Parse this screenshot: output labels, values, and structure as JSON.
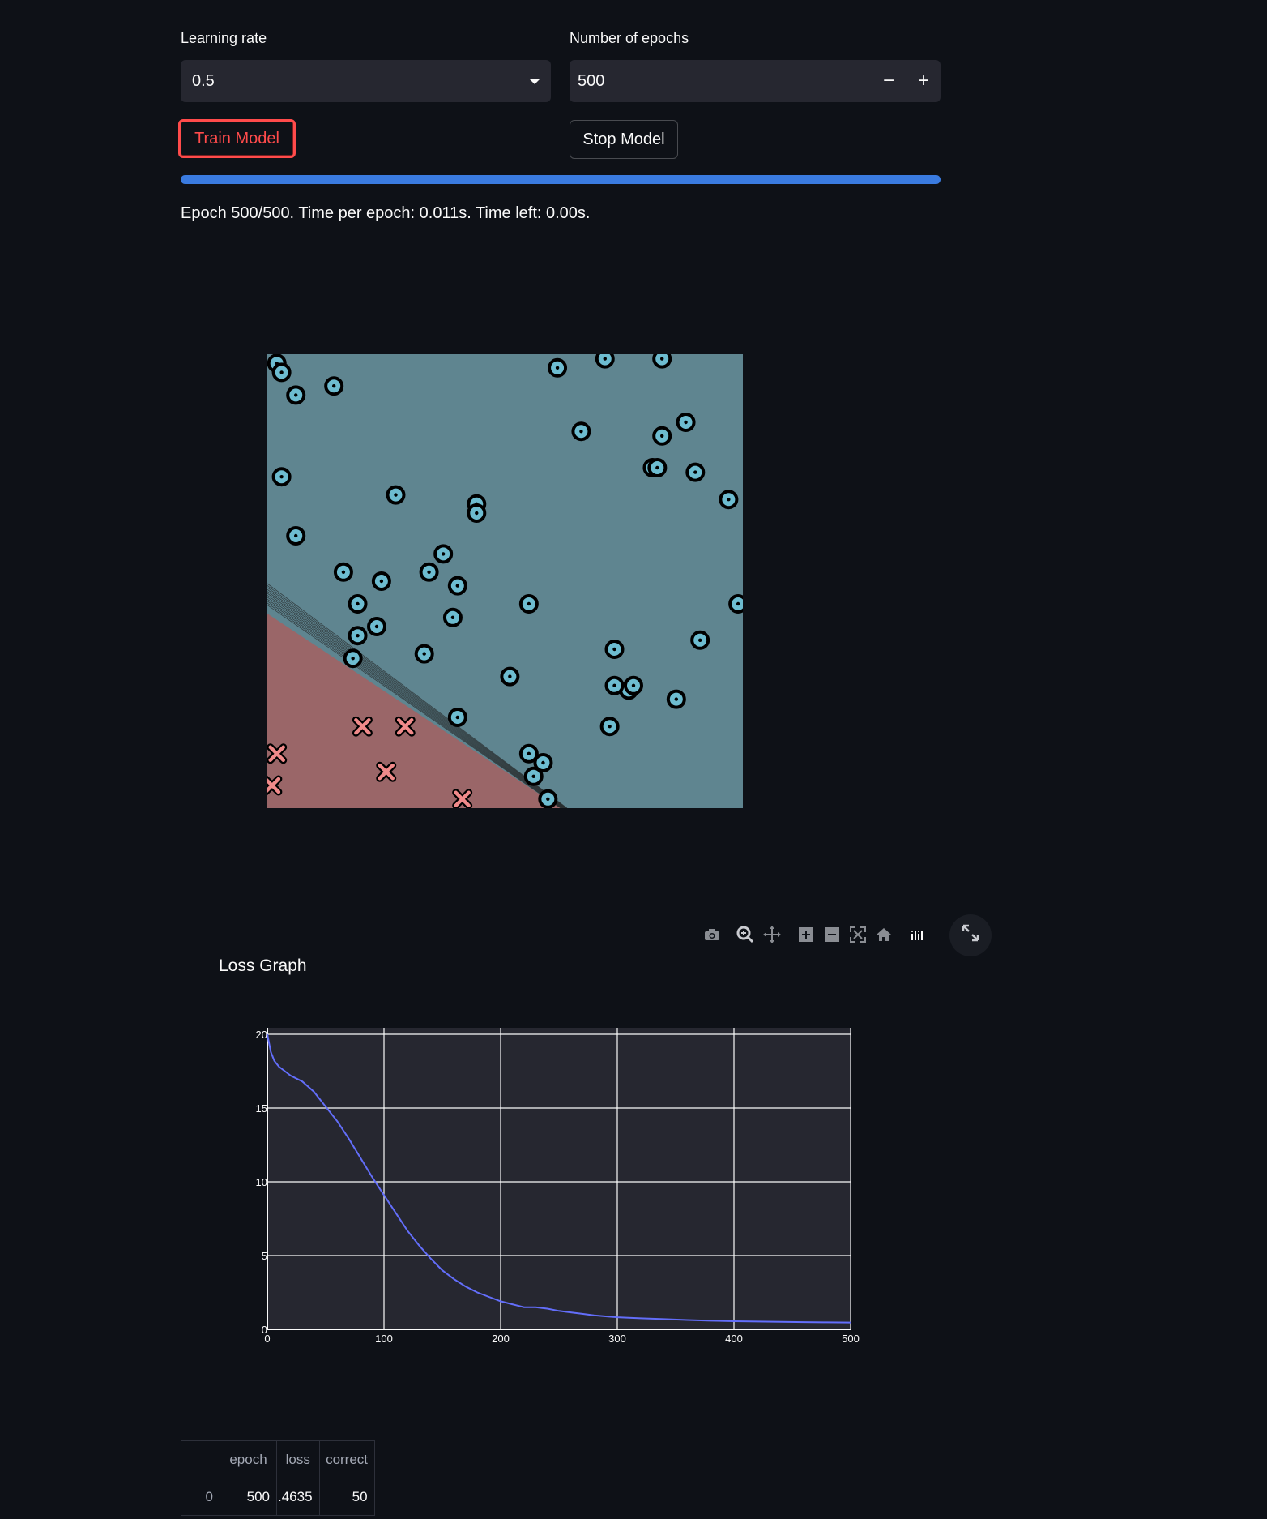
{
  "learning_rate": {
    "label": "Learning rate",
    "value": "0.5"
  },
  "epochs": {
    "label": "Number of epochs",
    "value": "500",
    "minus": "−",
    "plus": "+"
  },
  "buttons": {
    "train": "Train Model",
    "stop": "Stop Model"
  },
  "progress": {
    "fraction": 1.0,
    "color": "#3a7be0"
  },
  "status_text": "Epoch 500/500. Time per epoch: 0.011s. Time left: 0.00s.",
  "decision_plot": {
    "colors": {
      "region_a": "#5f8590",
      "region_b": "#9a6668",
      "point_circle": "#6dbcd0",
      "point_cross": "#f08a8a"
    },
    "circle_points": [
      [
        0.02,
        0.98
      ],
      [
        0.03,
        0.96
      ],
      [
        0.06,
        0.91
      ],
      [
        0.14,
        0.93
      ],
      [
        0.61,
        0.97
      ],
      [
        0.71,
        0.99
      ],
      [
        0.83,
        0.99
      ],
      [
        0.66,
        0.83
      ],
      [
        0.88,
        0.85
      ],
      [
        0.83,
        0.82
      ],
      [
        0.81,
        0.75
      ],
      [
        0.82,
        0.75
      ],
      [
        0.9,
        0.74
      ],
      [
        0.97,
        0.68
      ],
      [
        0.03,
        0.73
      ],
      [
        0.27,
        0.69
      ],
      [
        0.44,
        0.67
      ],
      [
        0.44,
        0.65
      ],
      [
        0.06,
        0.6
      ],
      [
        0.37,
        0.56
      ],
      [
        0.16,
        0.52
      ],
      [
        0.24,
        0.5
      ],
      [
        0.34,
        0.52
      ],
      [
        0.4,
        0.49
      ],
      [
        0.19,
        0.45
      ],
      [
        0.23,
        0.4
      ],
      [
        0.39,
        0.42
      ],
      [
        0.55,
        0.45
      ],
      [
        0.99,
        0.45
      ],
      [
        0.19,
        0.38
      ],
      [
        0.18,
        0.33
      ],
      [
        0.33,
        0.34
      ],
      [
        0.51,
        0.29
      ],
      [
        0.73,
        0.35
      ],
      [
        0.91,
        0.37
      ],
      [
        0.76,
        0.26
      ],
      [
        0.73,
        0.27
      ],
      [
        0.77,
        0.27
      ],
      [
        0.86,
        0.24
      ],
      [
        0.72,
        0.18
      ],
      [
        0.4,
        0.2
      ],
      [
        0.55,
        0.12
      ],
      [
        0.58,
        0.1
      ],
      [
        0.56,
        0.07
      ],
      [
        0.59,
        0.02
      ]
    ],
    "cross_points": [
      [
        0.2,
        0.18
      ],
      [
        0.29,
        0.18
      ],
      [
        0.02,
        0.12
      ],
      [
        0.25,
        0.08
      ],
      [
        0.01,
        0.05
      ],
      [
        0.41,
        0.02
      ]
    ]
  },
  "toolbar_icons": [
    "camera-icon",
    "zoom-icon",
    "pan-icon",
    "zoom-in-icon",
    "zoom-out-icon",
    "autoscale-icon",
    "home-icon",
    "plotly-logo-icon"
  ],
  "chart_data": {
    "type": "line",
    "title": "Loss Graph",
    "xlabel": "",
    "ylabel": "",
    "xlim": [
      0,
      500
    ],
    "ylim": [
      0,
      20
    ],
    "xticks": [
      0,
      100,
      200,
      300,
      400,
      500
    ],
    "yticks": [
      0,
      5,
      10,
      15,
      20
    ],
    "grid": true,
    "line_color": "#636efa",
    "series": [
      {
        "x": [
          0,
          3,
          6,
          10,
          15,
          20,
          30,
          40,
          50,
          60,
          70,
          80,
          90,
          100,
          110,
          120,
          130,
          140,
          150,
          160,
          170,
          180,
          190,
          200,
          210,
          220,
          230,
          240,
          250,
          260,
          270,
          280,
          290,
          300,
          320,
          340,
          360,
          380,
          400,
          420,
          440,
          460,
          480,
          500
        ],
        "values": [
          20,
          18.8,
          18.2,
          17.8,
          17.5,
          17.2,
          16.8,
          16.1,
          15.1,
          14.1,
          12.9,
          11.6,
          10.3,
          9.1,
          7.9,
          6.7,
          5.7,
          4.8,
          4.0,
          3.4,
          2.9,
          2.5,
          2.2,
          1.9,
          1.7,
          1.5,
          1.5,
          1.4,
          1.25,
          1.15,
          1.05,
          0.95,
          0.88,
          0.82,
          0.75,
          0.69,
          0.63,
          0.58,
          0.55,
          0.53,
          0.51,
          0.49,
          0.47,
          0.46
        ]
      }
    ]
  },
  "table": {
    "headers": [
      "",
      "epoch",
      "loss",
      "correct"
    ],
    "rows": [
      [
        "0",
        "500",
        ".4635",
        "50"
      ]
    ]
  }
}
